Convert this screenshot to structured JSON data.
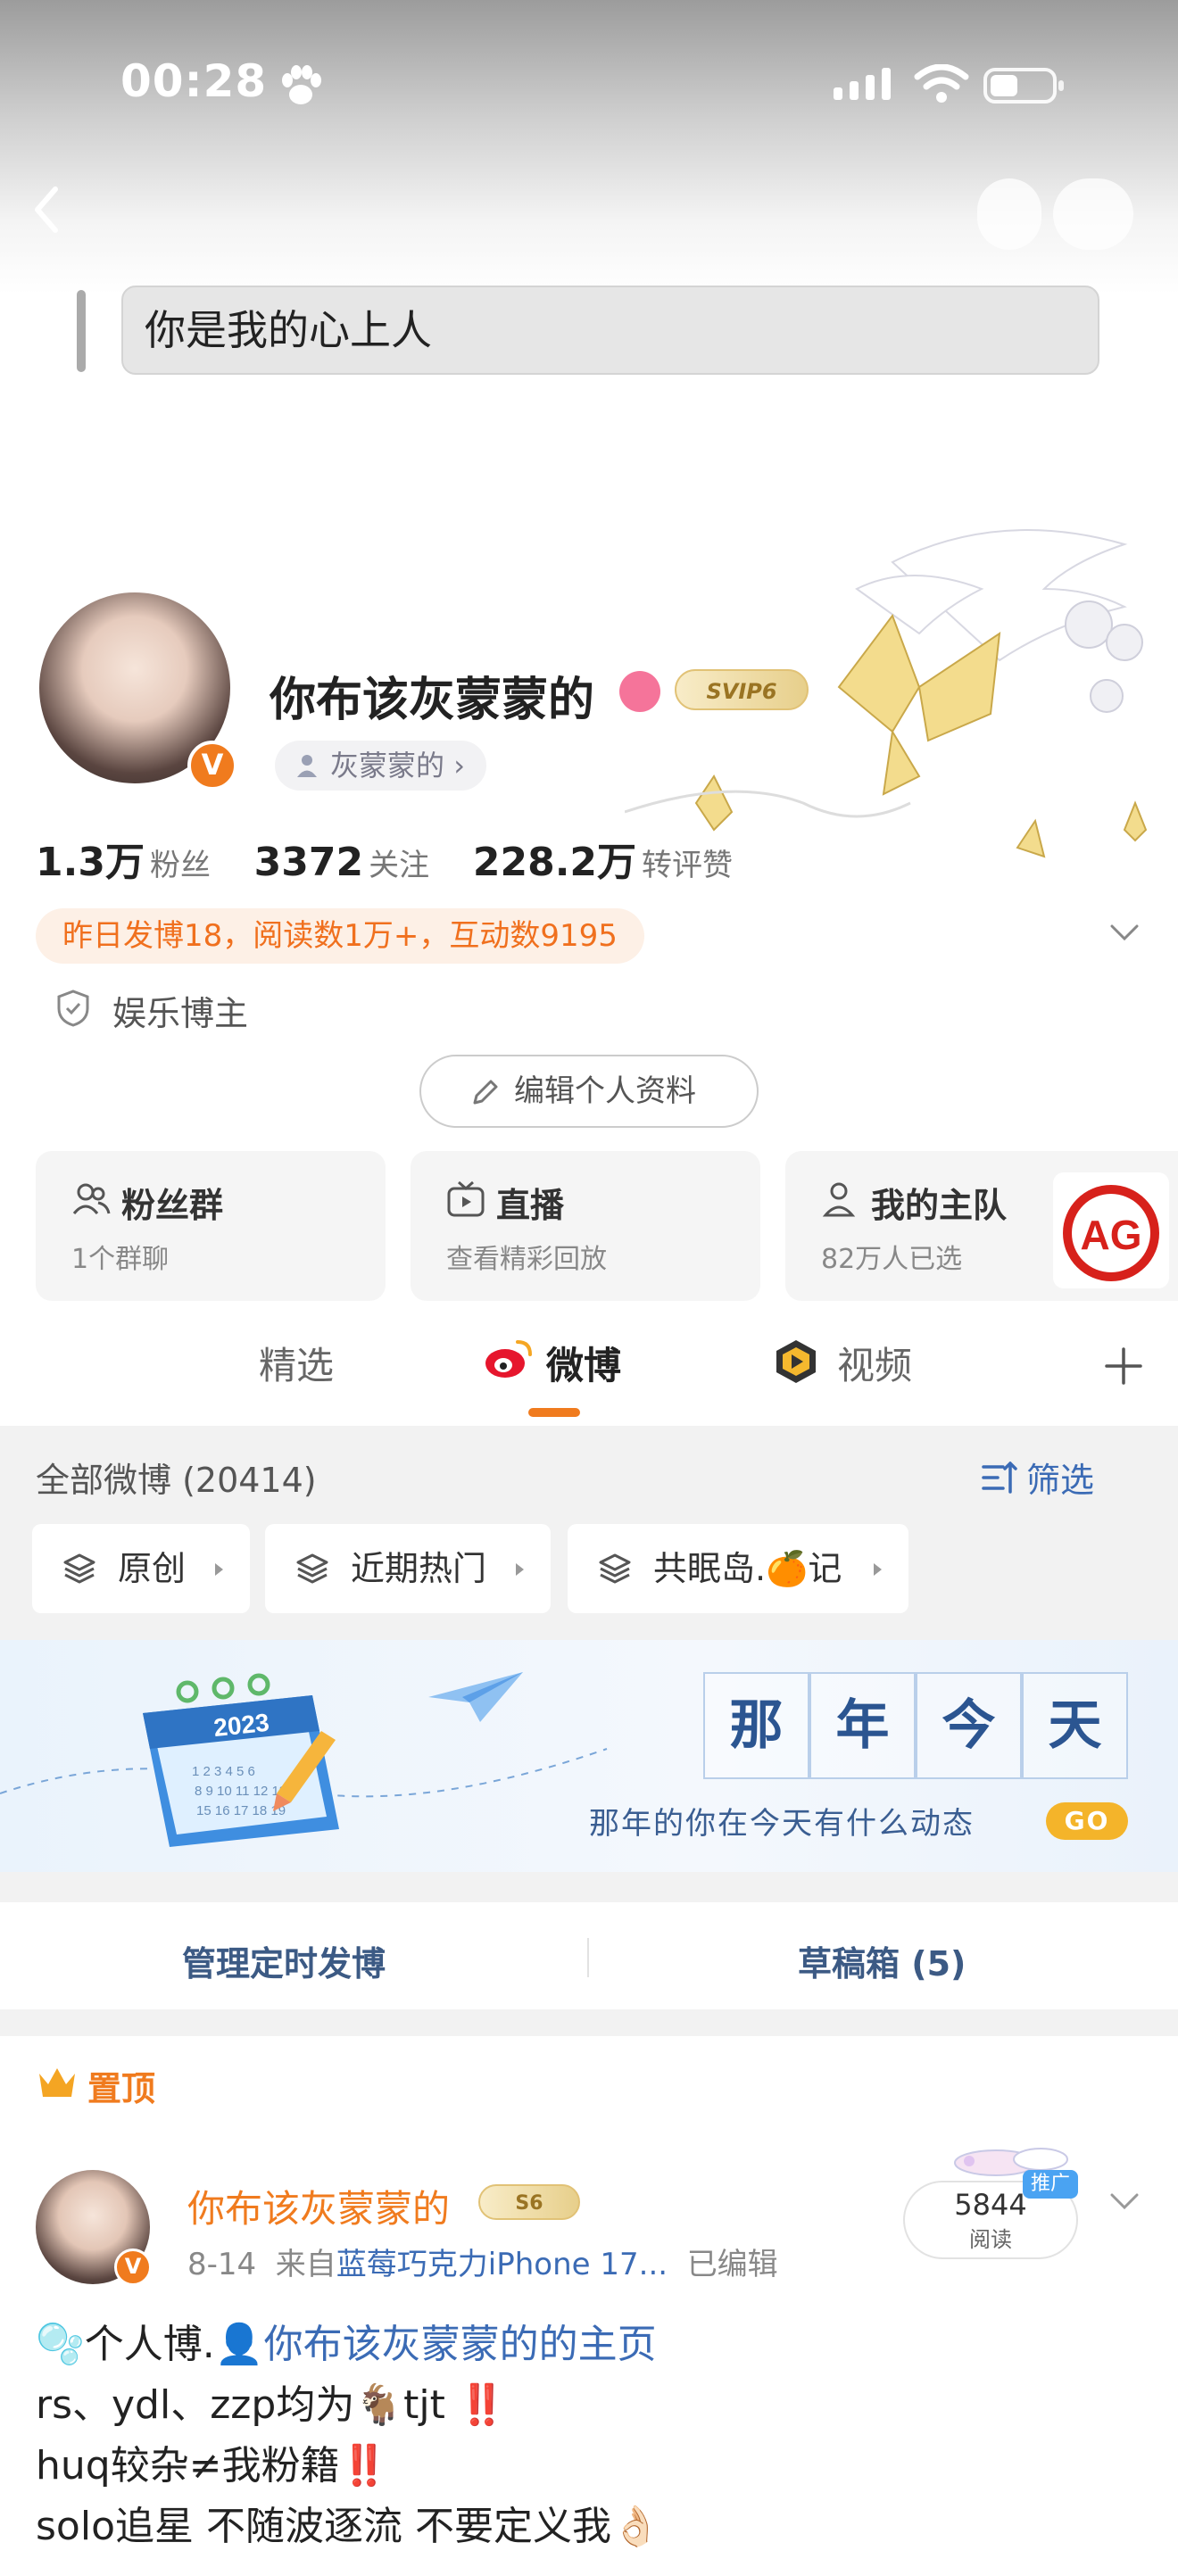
{
  "status_bar": {
    "time": "00:28"
  },
  "signature": {
    "text": "你是我的心上人"
  },
  "profile": {
    "name": "你布该灰蒙蒙的",
    "svip": "SVIP6",
    "name_tag": "灰蒙蒙的",
    "stats": [
      {
        "value": "1.3万",
        "label": "粉丝"
      },
      {
        "value": "3372",
        "label": "关注"
      },
      {
        "value": "228.2万",
        "label": "转评赞"
      }
    ],
    "yesterday_summary": "昨日发博18，阅读数1万+，互动数9195",
    "category": "娱乐博主",
    "edit_button": "编辑个人资料"
  },
  "cards": [
    {
      "title": "粉丝群",
      "subtitle": "1个群聊"
    },
    {
      "title": "直播",
      "subtitle": "查看精彩回放"
    },
    {
      "title": "我的主队",
      "subtitle": "82万人已选"
    }
  ],
  "tabs": [
    {
      "label": "精选"
    },
    {
      "label": "微博"
    },
    {
      "label": "视频"
    }
  ],
  "filter": {
    "all_label": "全部微博 (20414)",
    "filter_button": "筛选",
    "chips": [
      "原创",
      "近期热门",
      "共眠岛.🍊记"
    ]
  },
  "banner": {
    "chars": [
      "那",
      "年",
      "今",
      "天"
    ],
    "caption": "那年的你在今天有什么动态",
    "go": "GO",
    "calendar_year": "2023"
  },
  "manage": {
    "scheduled": "管理定时发博",
    "drafts": "草稿箱 (5)"
  },
  "pinned_post": {
    "pinned_label": "置顶",
    "author": "你布该灰蒙蒙的",
    "badge": "S6",
    "date": "8-14",
    "source_prefix": "来自",
    "source": "蓝莓巧克力iPhone 17...",
    "edited": "已编辑",
    "read_count": "5844",
    "read_label": "阅读",
    "promote": "推广",
    "lines": {
      "l1_prefix": "🫧个人博.",
      "l1_link": "你布该灰蒙蒙的的主页",
      "l2_text": "rs、ydl、zzp均为🐐tjt",
      "l3_text": "huq较杂≠我粉籍",
      "l4_text": "solo追星 不随波逐流 不要定义我👌🏻",
      "bang": "‼️"
    }
  },
  "colors": {
    "accent": "#f07b1e",
    "link": "#3b6bb5",
    "panel": "#f2f2f2"
  }
}
